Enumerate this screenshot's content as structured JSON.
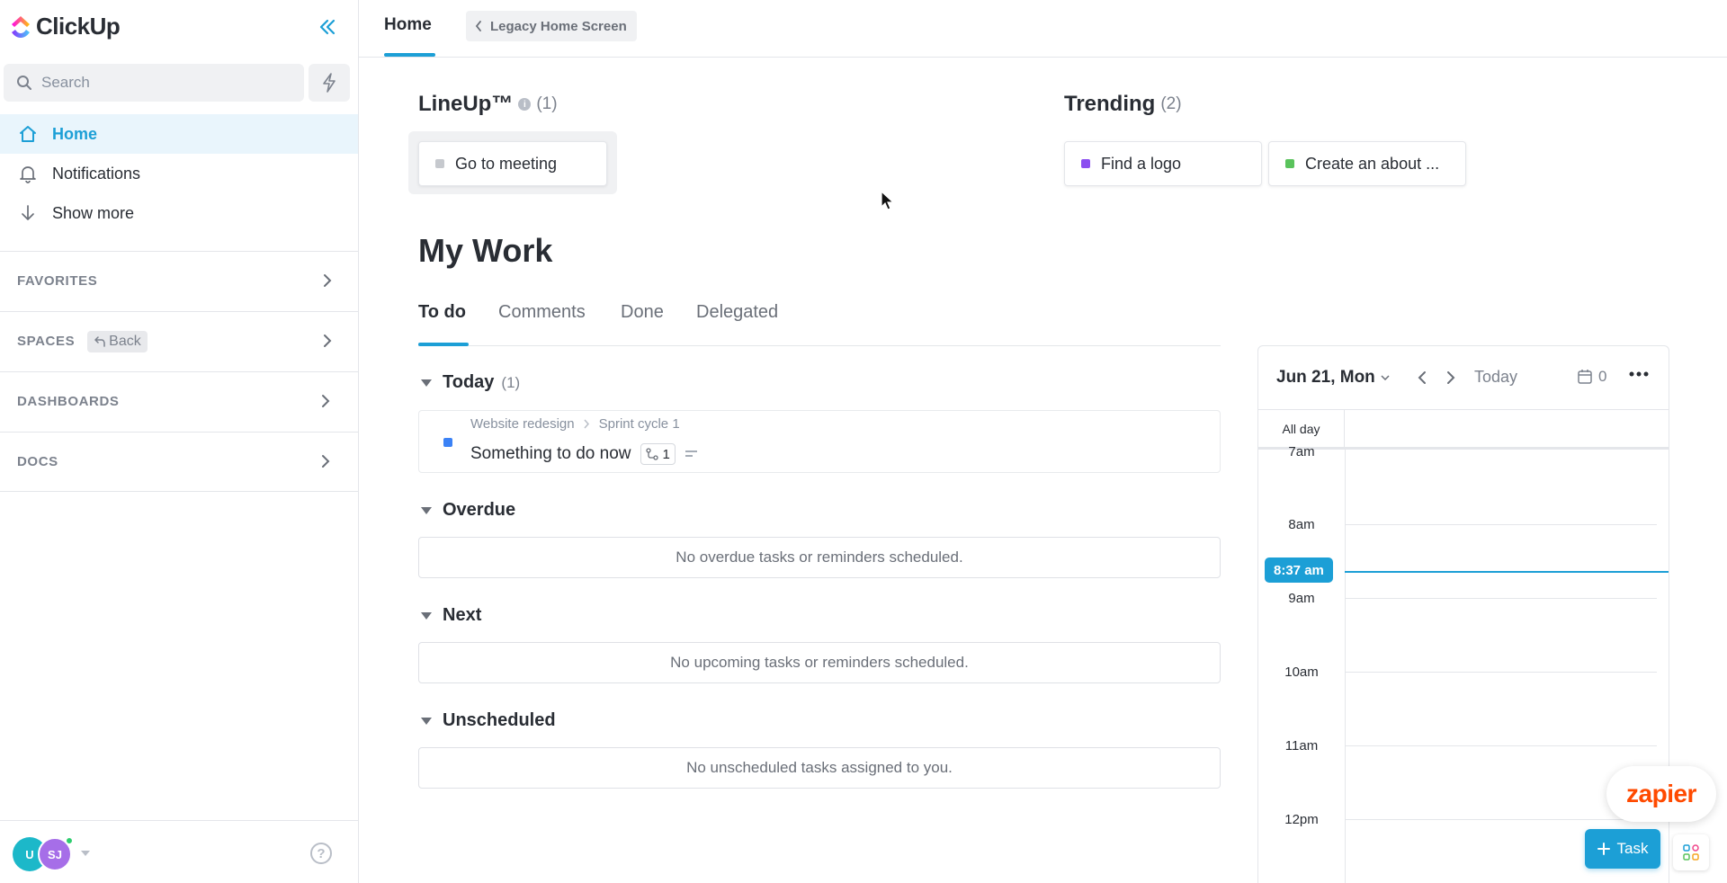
{
  "app": {
    "name": "ClickUp"
  },
  "sidebar": {
    "search_placeholder": "Search",
    "nav": [
      {
        "label": "Home",
        "icon": "home-icon",
        "active": true
      },
      {
        "label": "Notifications",
        "icon": "bell-icon"
      },
      {
        "label": "Show more",
        "icon": "arrow-down-icon"
      }
    ],
    "sections": {
      "favorites": "FAVORITES",
      "spaces": "SPACES",
      "spaces_back": "Back",
      "dashboards": "DASHBOARDS",
      "docs": "DOCS"
    },
    "avatars": [
      {
        "initials": "U",
        "color": "#1cb8c9"
      },
      {
        "initials": "SJ",
        "color": "#a66ee8"
      }
    ],
    "help_label": "?"
  },
  "header": {
    "tab": "Home",
    "legacy_button": "Legacy Home Screen"
  },
  "lineup": {
    "title": "LineUp™",
    "count": "(1)",
    "tasks": [
      {
        "name": "Go to meeting",
        "color": "#c6c9ce"
      }
    ]
  },
  "trending": {
    "title": "Trending",
    "count": "(2)",
    "tasks": [
      {
        "name": "Find a logo",
        "color": "#8b4ef0"
      },
      {
        "name": "Create an about ...",
        "color": "#5ac35c"
      }
    ]
  },
  "my_work": {
    "title": "My Work",
    "tabs": [
      {
        "label": "To do",
        "active": true
      },
      {
        "label": "Comments"
      },
      {
        "label": "Done"
      },
      {
        "label": "Delegated"
      }
    ],
    "groups": {
      "today": {
        "label": "Today",
        "count": "(1)"
      },
      "overdue": {
        "label": "Overdue",
        "empty": "No overdue tasks or reminders scheduled."
      },
      "next": {
        "label": "Next",
        "empty": "No upcoming tasks or reminders scheduled."
      },
      "unscheduled": {
        "label": "Unscheduled",
        "empty": "No unscheduled tasks assigned to you."
      }
    },
    "today_task": {
      "list": "Website redesign",
      "folder": "Sprint cycle 1",
      "name": "Something to do now",
      "subtasks": "1",
      "status_color": "#3b82f6"
    }
  },
  "calendar": {
    "date": "Jun 21, Mon",
    "today": "Today",
    "count": "0",
    "all_day": "All day",
    "hours": [
      "7am",
      "8am",
      "9am",
      "10am",
      "11am",
      "12pm"
    ],
    "now": "8:37 am"
  },
  "floating": {
    "zapier": "zapier",
    "task_button": "Task"
  },
  "colors": {
    "accent": "#1c9fd6",
    "zapier": "#ff4a00"
  }
}
